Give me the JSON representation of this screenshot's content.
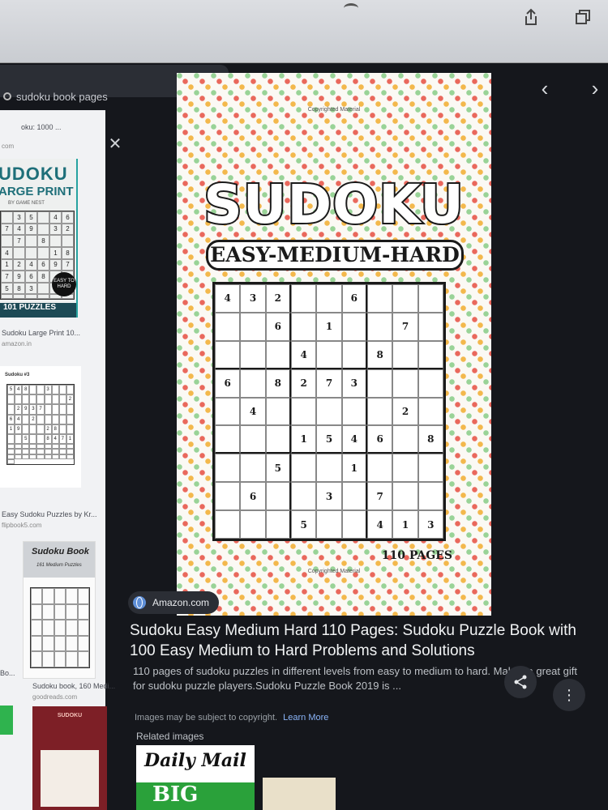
{
  "search": {
    "query": "sudoku book pages"
  },
  "results": [
    {
      "title_partial": "oku: 1000 ...",
      "source_partial": "com",
      "cover_title": "UDOKU",
      "cover_subtitle": "ARGE PRINT",
      "cover_byline": "BY GAME NEST",
      "cover_grid": [
        "",
        "3",
        "5",
        "",
        "4",
        "6",
        "7",
        "4",
        "9",
        "",
        "3",
        "2",
        "",
        "7",
        "",
        "8",
        "",
        "",
        "4",
        "",
        "",
        "",
        "1",
        "8",
        "1",
        "2",
        "4",
        "6",
        "9",
        "7",
        "7",
        "9",
        "6",
        "8",
        "",
        "4",
        "5",
        "8",
        "3",
        "",
        "7",
        "2",
        "",
        "",
        "",
        "",
        "",
        ""
      ],
      "badge": "EASY TO HARD",
      "footer": "101 PUZZLES",
      "caption": "Sudoku Large Print 10...",
      "source": "amazon.in"
    },
    {
      "cover_title": "Sudoku #3",
      "cover_grid": [
        "5",
        "4",
        "8",
        "",
        "",
        "3",
        "",
        "",
        "",
        "",
        "",
        "",
        "",
        "",
        "",
        "",
        "",
        "2",
        "",
        "2",
        "9",
        "3",
        "7",
        "",
        "",
        "",
        "",
        "6",
        "4",
        "",
        "2",
        "",
        "",
        "",
        "",
        "",
        "1",
        "9",
        "",
        "",
        "",
        "2",
        "8",
        "",
        "",
        "",
        "",
        "5",
        "",
        "",
        "8",
        "4",
        "7",
        "1",
        "",
        "",
        "",
        "",
        "",
        "",
        "",
        "",
        "",
        "",
        "",
        "",
        "",
        "",
        "",
        "",
        "",
        "",
        "",
        "",
        "",
        "",
        "",
        "",
        "",
        "",
        "",
        ""
      ],
      "caption": "Easy Sudoku Puzzles by Kr...",
      "source": "flipbook5.com"
    },
    {
      "cover_title": "Sudoku Book",
      "cover_subtitle": "161 Medium Puzzles",
      "cover_grid": [
        "",
        "",
        "",
        "",
        "",
        "",
        "",
        "",
        "",
        "",
        "",
        "",
        "",
        "",
        "",
        "",
        "",
        "",
        "",
        "",
        "",
        "",
        "",
        "",
        ""
      ],
      "caption": "Sudoku book, 160 Medi...",
      "source": "goodreads.com",
      "left_caption": "Bo..."
    },
    {
      "cover_title": "SUDOKU"
    }
  ],
  "preview": {
    "copyright": "Copyrighted Material",
    "title": "SUDOKU",
    "subtitle": "EASY-MEDIUM-HARD",
    "grid": [
      [
        "4",
        "3",
        "2",
        "",
        "",
        "6",
        "",
        "",
        ""
      ],
      [
        "",
        "",
        "6",
        "",
        "1",
        "",
        "",
        "7",
        ""
      ],
      [
        "",
        "",
        "",
        "4",
        "",
        "",
        "8",
        "",
        ""
      ],
      [
        "6",
        "",
        "8",
        "2",
        "7",
        "3",
        "",
        "",
        ""
      ],
      [
        "",
        "4",
        "",
        "",
        "",
        "",
        "",
        "2",
        ""
      ],
      [
        "",
        "",
        "",
        "1",
        "5",
        "4",
        "6",
        "",
        "8"
      ],
      [
        "",
        "",
        "5",
        "",
        "",
        "1",
        "",
        "",
        ""
      ],
      [
        "",
        "6",
        "",
        "",
        "3",
        "",
        "7",
        "",
        ""
      ],
      [
        "",
        "",
        "",
        "5",
        "",
        "",
        "4",
        "1",
        "3"
      ]
    ],
    "pages": "110 PAGES"
  },
  "detail": {
    "source": "Amazon.com",
    "title": "Sudoku Easy Medium Hard 110 Pages: Sudoku Puzzle Book with 100 Easy Medium to Hard Problems and Solutions",
    "description": "110 pages of sudoku puzzles in different levels from easy to medium to hard. Makes a great gift for sudoku puzzle players.Sudoku Puzzle Book 2019 is ...",
    "copyright_note": "Images may be subject to copyright.",
    "learn_more": "Learn More",
    "related_label": "Related images",
    "related_first_top": "Daily",
    "related_first_top2": "Mail",
    "related_first_bottom": "BIG"
  },
  "icons": {
    "share_top": "share-icon",
    "tabs_top": "tabs-icon",
    "close": "close-icon",
    "prev": "chevron-left-icon",
    "next": "chevron-right-icon",
    "reload": "reload-icon",
    "share": "share-icon",
    "more": "more-vertical-icon"
  },
  "glyphs": {
    "close": "✕",
    "prev": "‹",
    "next": "›",
    "more": "⋮"
  }
}
